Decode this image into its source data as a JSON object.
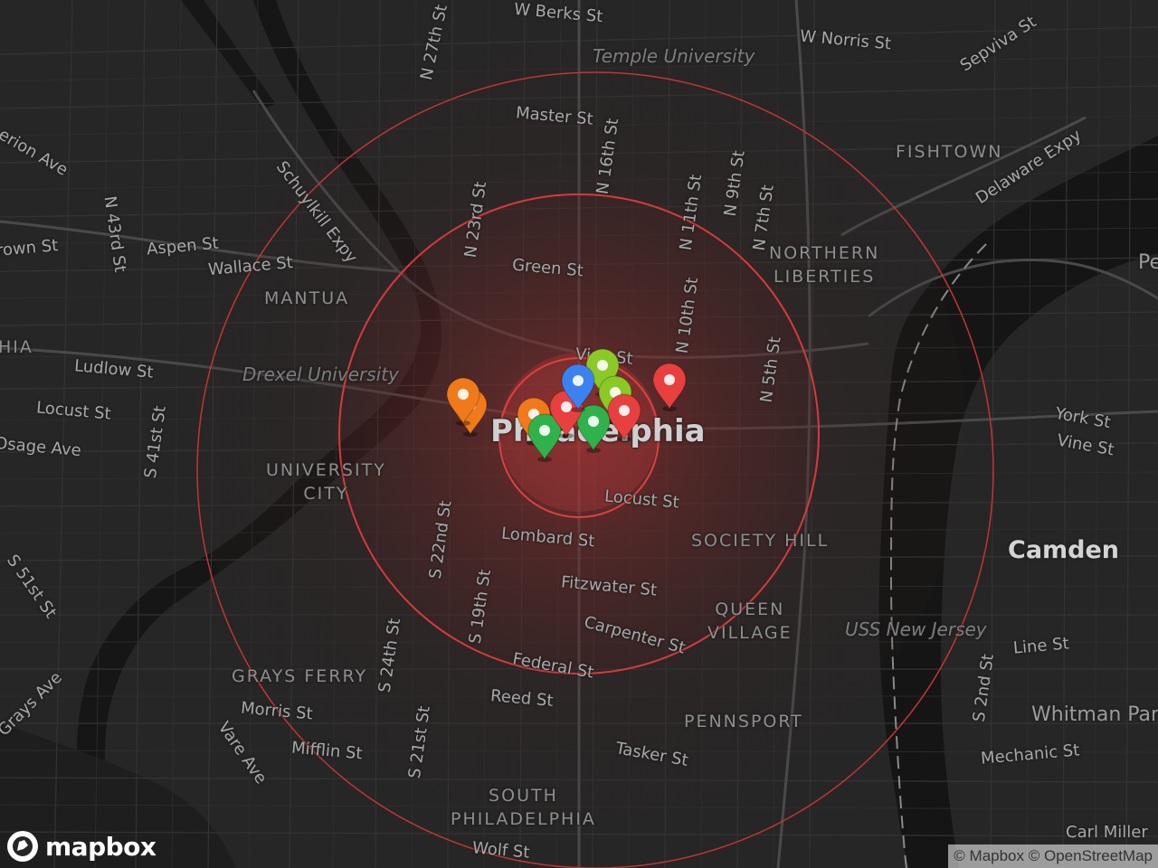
{
  "map": {
    "colors": {
      "background": "#262626",
      "road_minor": "#3a3a3a",
      "road_major": "#4a4a4a",
      "water": "#151515",
      "park": "#2c2c2c",
      "radius_ring": "#d93a3a",
      "heat_center": "#a33030"
    },
    "labels": {
      "w_berks_st": "W Berks St",
      "n_27th_st": "N 27th St",
      "w_norris_st": "W Norris St",
      "sepviva_st": "Sepviva St",
      "temple_university": "Temple University",
      "master_st": "Master St",
      "n_16th_st": "N 16th St",
      "fishtown": "FISHTOWN",
      "delaware_expy": "Delaware Expy",
      "erion_ave": "erion Ave",
      "schuylkill_expy": "Schuylkill Expy",
      "n_23rd_st": "N 23rd St",
      "n_11th_st": "N 11th St",
      "n_9th_st": "N 9th St",
      "n_7th_st": "N 7th St",
      "n_43rd_st": "N 43rd St",
      "aspen_st": "Aspen St",
      "brown_st": "rown St",
      "wallace_st": "Wallace St",
      "green_st": "Green St",
      "northern_liberties": "NORTHERN\nLIBERTIES",
      "mantua": "MANTUA",
      "n_10th_st": "N 10th St",
      "hia": "HIA",
      "ludlow_st": "Ludlow St",
      "vine_st_center": "Vine St",
      "n_5th_st": "N 5th St",
      "drexel_university": "Drexel University",
      "locust_st_w": "Locust St",
      "s_41st_st": "S 41st St",
      "osage_ave": "Osage Ave",
      "philadelphia": "Philadelphia",
      "york_st": "York St",
      "vine_st_camden": "Vine St",
      "university_city": "UNIVERSITY\nCITY",
      "locust_st_center": "Locust St",
      "s_22nd_st": "S 22nd St",
      "lombard_st": "Lombard St",
      "society_hill": "SOCIETY HILL",
      "camden": "Camden",
      "s_51st_st": "S 51st St",
      "fitzwater_st": "Fitzwater St",
      "s_19th_st": "S 19th St",
      "queen_village": "QUEEN\nVILLAGE",
      "uss_new_jersey": "USS New Jersey",
      "carpenter_st": "Carpenter St",
      "line_st": "Line St",
      "s_24th_st": "S 24th St",
      "federal_st": "Federal St",
      "grays_ferry": "GRAYS FERRY",
      "grays_ave": "Grays Ave",
      "s_2nd_st": "S 2nd St",
      "reed_st": "Reed St",
      "morris_st": "Morris St",
      "pennsport": "PENNSPORT",
      "whitman_park": "Whitman Par",
      "vare_ave": "Vare Ave",
      "mifflin_st": "Mifflin St",
      "s_21st_st": "S 21st St",
      "tasker_st": "Tasker St",
      "mechanic_st": "Mechanic St",
      "south_philadelphia": "SOUTH\nPHILADELPHIA",
      "carl_miller": "Carl Miller",
      "wolf_st": "Wolf St",
      "pe": "Pe"
    },
    "markers": [
      {
        "name": "marker-orange-1",
        "color": "#f07a1a"
      },
      {
        "name": "marker-orange-2",
        "color": "#f07a1a"
      },
      {
        "name": "marker-orange-3",
        "color": "#f07a1a"
      },
      {
        "name": "marker-green-1",
        "color": "#8ac926"
      },
      {
        "name": "marker-green-2",
        "color": "#8ac926"
      },
      {
        "name": "marker-green-3",
        "color": "#2fb24b"
      },
      {
        "name": "marker-green-4",
        "color": "#2fb24b"
      },
      {
        "name": "marker-red-1",
        "color": "#e8403e"
      },
      {
        "name": "marker-red-2",
        "color": "#e8403e"
      },
      {
        "name": "marker-red-3",
        "color": "#e8403e"
      },
      {
        "name": "marker-blue-1",
        "color": "#3b82f0"
      }
    ],
    "logo": "mapbox",
    "attribution": "© Mapbox © OpenStreetMap"
  }
}
